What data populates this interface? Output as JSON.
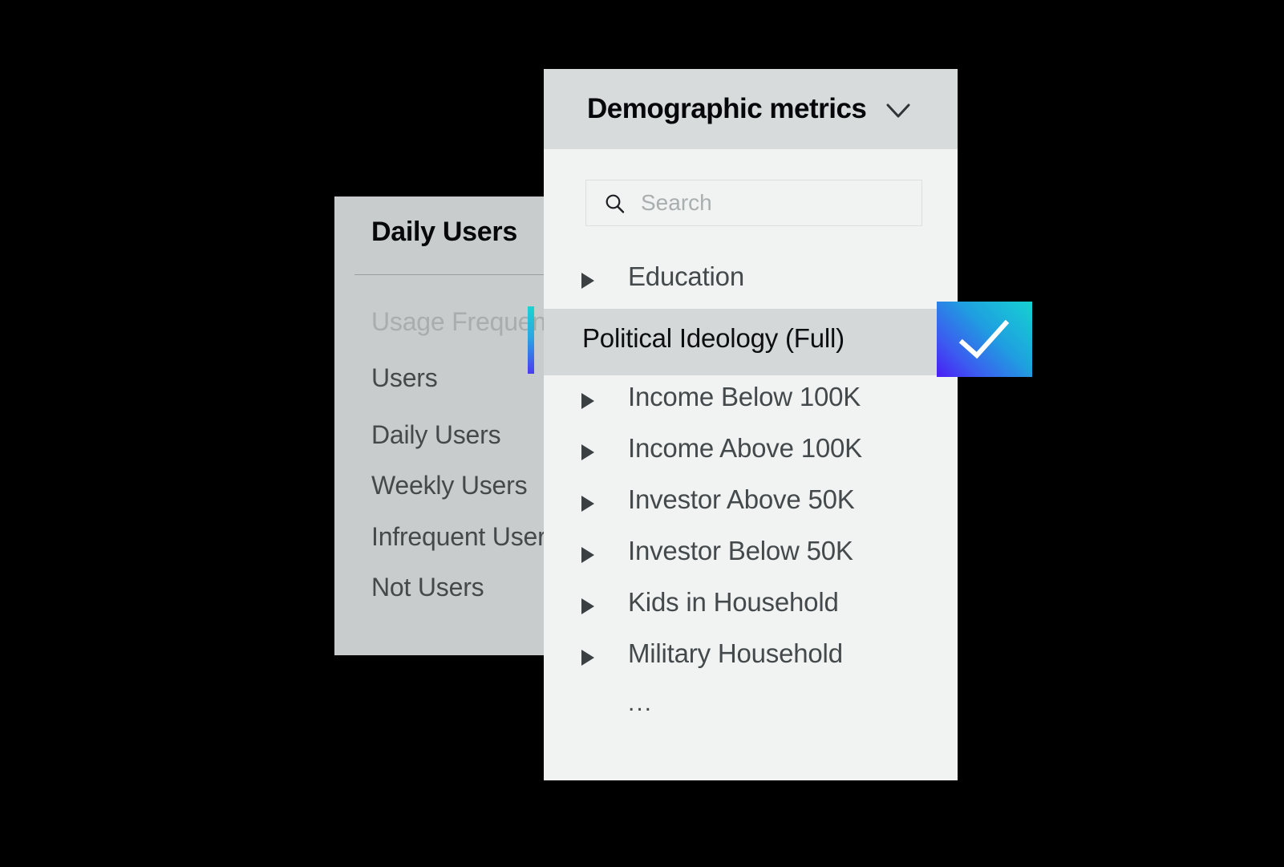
{
  "metric_card": {
    "title": "Daily Users",
    "items": [
      {
        "label": "Usage Frequency",
        "muted": true
      },
      {
        "label": "Users",
        "muted": false
      },
      {
        "label": "Daily Users",
        "muted": false
      },
      {
        "label": "Weekly Users",
        "muted": false
      },
      {
        "label": "Infrequent Users",
        "muted": false
      },
      {
        "label": "Not Users",
        "muted": false
      }
    ]
  },
  "dropdown": {
    "title": "Demographic metrics",
    "chevron_icon": "chevron-down-icon",
    "search": {
      "icon": "search-icon",
      "placeholder": "Search",
      "value": ""
    },
    "options": [
      {
        "label": "Education",
        "expandable": true,
        "selected": false
      },
      {
        "label": "Political Ideology (Full)",
        "expandable": false,
        "selected": true
      },
      {
        "label": "Income Below 100K",
        "expandable": true,
        "selected": false
      },
      {
        "label": "Income Above 100K",
        "expandable": true,
        "selected": false
      },
      {
        "label": "Investor Above 50K",
        "expandable": true,
        "selected": false
      },
      {
        "label": "Investor Below 50K",
        "expandable": true,
        "selected": false
      },
      {
        "label": "Kids in Household",
        "expandable": true,
        "selected": false
      },
      {
        "label": "Military Household",
        "expandable": true,
        "selected": false
      },
      {
        "label": "...",
        "expandable": false,
        "selected": false
      }
    ]
  },
  "confirm_button": {
    "icon": "check-icon",
    "gradient_start": "#4a1cf5",
    "gradient_end": "#15d2d2"
  },
  "accent_bar": {
    "gradient_start": "#18d5d0",
    "gradient_end": "#4a3bf5"
  }
}
